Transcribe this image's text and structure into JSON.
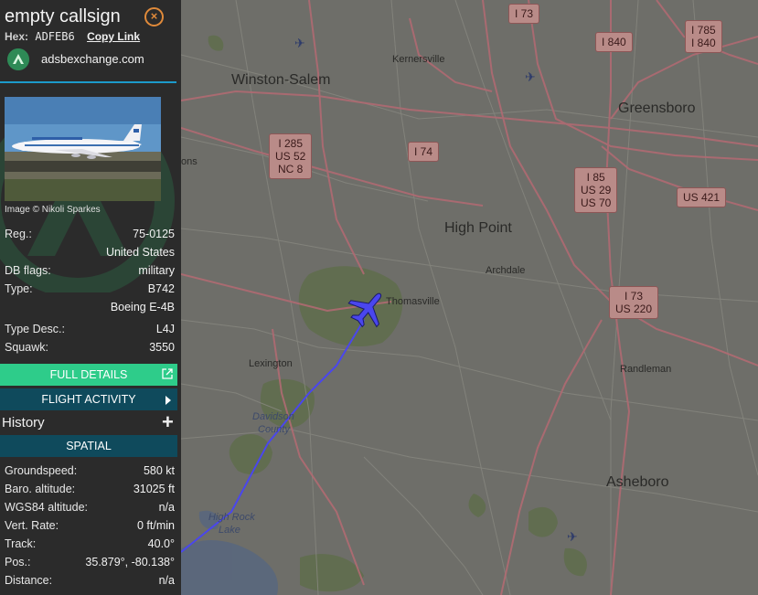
{
  "aircraft": {
    "callsign": "empty callsign",
    "hex_label": "Hex:",
    "hex_value": "ADFEB6",
    "copy_link": "Copy Link",
    "site": "adsbexchange.com",
    "photo_credit": "Image © Nikoli Sparkes"
  },
  "details": [
    {
      "key": "Reg.:",
      "value": "75-0125"
    },
    {
      "key": "",
      "value": "United States"
    },
    {
      "key": "DB flags:",
      "value": "military"
    },
    {
      "key": "Type:",
      "value": "B742"
    },
    {
      "key": "",
      "value": "Boeing E-4B"
    },
    {
      "key": "Type Desc.:",
      "value": "L4J"
    },
    {
      "key": "Squawk:",
      "value": "3550"
    }
  ],
  "buttons": {
    "full_details": "FULL DETAILS",
    "flight_activity": "FLIGHT ACTIVITY",
    "history": "History",
    "spatial": "SPATIAL"
  },
  "spatial": [
    {
      "key": "Groundspeed:",
      "value": "580 kt"
    },
    {
      "key": "Baro. altitude:",
      "value": "31025 ft"
    },
    {
      "key": "WGS84 altitude:",
      "value": "n/a"
    },
    {
      "key": "Vert. Rate:",
      "value": "0 ft/min"
    },
    {
      "key": "Track:",
      "value": "40.0°"
    },
    {
      "key": "Pos.:",
      "value": "35.879°, -80.138°"
    },
    {
      "key": "Distance:",
      "value": "n/a"
    }
  ],
  "map": {
    "cities": {
      "winston_salem": "Winston-Salem",
      "kernersville": "Kernersville",
      "greensboro": "Greensboro",
      "high_point": "High Point",
      "archdale": "Archdale",
      "thomasville": "Thomasville",
      "lexington": "Lexington",
      "randleman": "Randleman",
      "asheboro": "Asheboro",
      "davidson": "Davidson",
      "county": "County",
      "high_rock": "High Rock",
      "lake": "Lake",
      "ons": "ons"
    },
    "shields": {
      "i73_top": "I 73",
      "i840_a": "I 840",
      "i785": "I 785",
      "i840_b": "I 840",
      "i285": "I 285",
      "us52": "US 52",
      "nc8": "NC 8",
      "i74": "I 74",
      "i85": "I 85",
      "us29": "US 29",
      "us70": "US 70",
      "us421": "US 421",
      "i73_mid": "I 73",
      "us220": "US 220"
    },
    "track_color": "#4a46ee",
    "aircraft_icon": "airplane-icon"
  }
}
